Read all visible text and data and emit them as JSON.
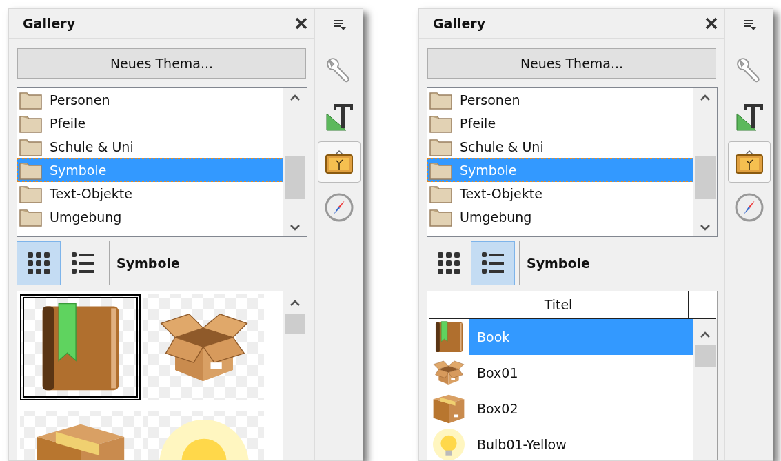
{
  "panels": [
    {
      "title": "Gallery",
      "new_theme_button": "Neues Thema...",
      "themes": [
        {
          "label": "Personen",
          "selected": false
        },
        {
          "label": "Pfeile",
          "selected": false
        },
        {
          "label": "Schule & Uni",
          "selected": false
        },
        {
          "label": "Symbole",
          "selected": true
        },
        {
          "label": "Text-Objekte",
          "selected": false
        },
        {
          "label": "Umgebung",
          "selected": false
        }
      ],
      "view_modes": [
        {
          "kind": "icons",
          "selected": true
        },
        {
          "kind": "details",
          "selected": false
        }
      ],
      "current_theme": "Symbole",
      "view": {
        "kind": "icons",
        "items": [
          {
            "kind": "book",
            "selected": true
          },
          {
            "kind": "box",
            "selected": false
          },
          {
            "kind": "box2",
            "selected": false
          },
          {
            "kind": "bulb",
            "selected": false
          }
        ]
      },
      "sidebar_tabs": [
        {
          "kind": "properties",
          "selected": false
        },
        {
          "kind": "styles",
          "selected": false
        },
        {
          "kind": "gallery",
          "selected": true
        },
        {
          "kind": "navigator",
          "selected": false
        }
      ]
    },
    {
      "title": "Gallery",
      "new_theme_button": "Neues Thema...",
      "themes": [
        {
          "label": "Personen",
          "selected": false
        },
        {
          "label": "Pfeile",
          "selected": false
        },
        {
          "label": "Schule & Uni",
          "selected": false
        },
        {
          "label": "Symbole",
          "selected": true
        },
        {
          "label": "Text-Objekte",
          "selected": false
        },
        {
          "label": "Umgebung",
          "selected": false
        }
      ],
      "view_modes": [
        {
          "kind": "icons",
          "selected": false
        },
        {
          "kind": "details",
          "selected": true
        }
      ],
      "current_theme": "Symbole",
      "view": {
        "kind": "details",
        "column": "Titel",
        "items": [
          {
            "kind": "book",
            "title": "Book",
            "selected": true
          },
          {
            "kind": "box",
            "title": "Box01",
            "selected": false
          },
          {
            "kind": "box2",
            "title": "Box02",
            "selected": false
          },
          {
            "kind": "bulb",
            "title": "Bulb01-Yellow",
            "selected": false
          }
        ]
      },
      "sidebar_tabs": [
        {
          "kind": "properties",
          "selected": false
        },
        {
          "kind": "styles",
          "selected": false
        },
        {
          "kind": "gallery",
          "selected": true
        },
        {
          "kind": "navigator",
          "selected": false
        }
      ]
    }
  ]
}
